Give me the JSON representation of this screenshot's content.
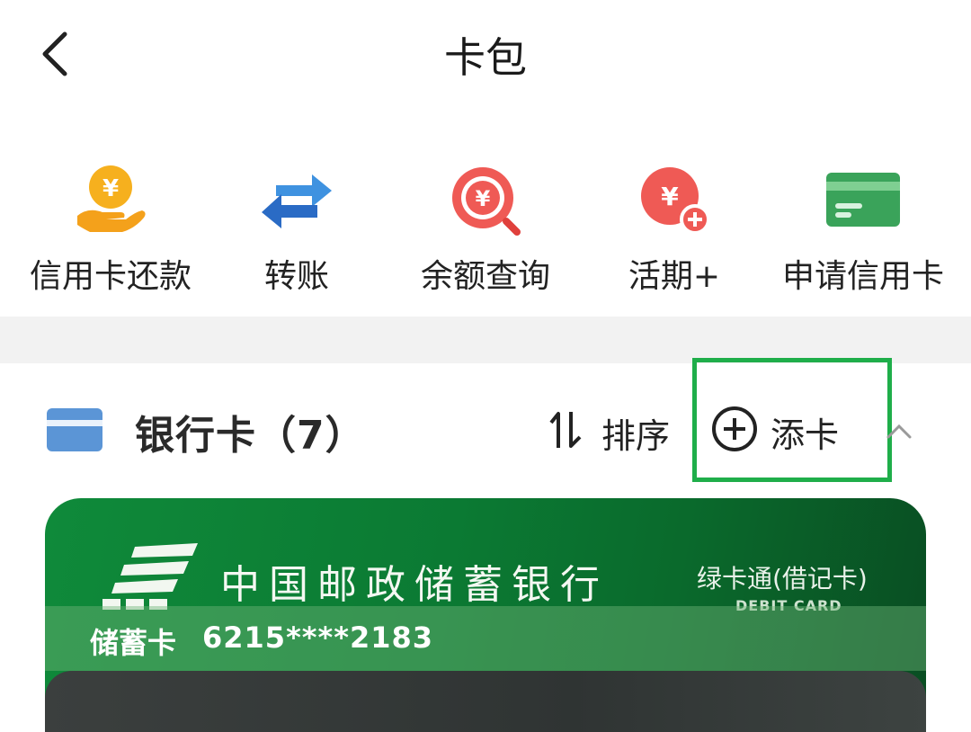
{
  "header": {
    "title": "卡包",
    "back_icon": "chevron-left-icon"
  },
  "quick_actions": [
    {
      "label": "信用卡还款",
      "icon": "hand-yuan-coin-icon"
    },
    {
      "label": "转账",
      "icon": "transfer-arrows-icon"
    },
    {
      "label": "余额查询",
      "icon": "yuan-search-icon"
    },
    {
      "label": "活期+",
      "icon": "yuan-plus-icon"
    },
    {
      "label": "申请信用卡",
      "icon": "credit-card-icon"
    }
  ],
  "section": {
    "title": "银行卡（7）",
    "sort_label": "排序",
    "add_label": "添卡",
    "collapse_icon": "chevron-up-icon"
  },
  "card": {
    "bank_name": "中国邮政储蓄银行",
    "product": "绿卡通(借记卡)",
    "product_en": "DEBIT CARD",
    "type": "储蓄卡",
    "number": "6215****2183"
  },
  "colors": {
    "accent_green": "#1fae4a",
    "card_green": "#0b7a33",
    "card_icon_blue": "#5b95d6"
  }
}
